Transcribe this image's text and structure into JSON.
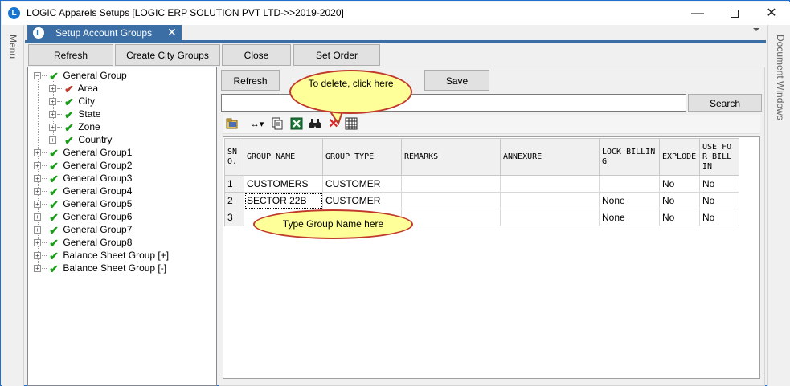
{
  "window": {
    "title": "LOGIC Apparels Setups  [LOGIC ERP SOLUTION PVT LTD->>2019-2020]",
    "logo_letter": "L",
    "minimize_glyph": "—",
    "close_glyph": "✕"
  },
  "sidebar_left": {
    "label": "Menu"
  },
  "sidebar_right": {
    "label": "Document Windows"
  },
  "tab": {
    "label": "Setup Account Groups",
    "icon_letter": "L",
    "close_glyph": "✕"
  },
  "top_buttons": {
    "refresh": "Refresh",
    "create_city_groups": "Create City Groups",
    "close": "Close",
    "set_order": "Set Order"
  },
  "tree": {
    "root": {
      "label": "General Group",
      "expander": "−"
    },
    "children": [
      {
        "label": "Area",
        "check_color": "#c0392b"
      },
      {
        "label": "City",
        "check_color": "#1a9b1a"
      },
      {
        "label": "State",
        "check_color": "#1a9b1a"
      },
      {
        "label": "Zone",
        "check_color": "#1a9b1a"
      },
      {
        "label": "Country",
        "check_color": "#1a9b1a"
      }
    ],
    "siblings": [
      {
        "label": "General Group1"
      },
      {
        "label": "General Group2"
      },
      {
        "label": "General Group3"
      },
      {
        "label": "General Group4"
      },
      {
        "label": "General Group5"
      },
      {
        "label": "General Group6"
      },
      {
        "label": "General Group7"
      },
      {
        "label": "General Group8"
      },
      {
        "label": "Balance Sheet Group [+]"
      },
      {
        "label": "Balance Sheet Group [-]"
      }
    ],
    "check_glyph": "✔",
    "collapsed_glyph": "+"
  },
  "main": {
    "refresh_label": "Refresh",
    "save_label": "Save",
    "search_value": "",
    "search_label": "Search"
  },
  "toolbar": {
    "icons": [
      "folder-icon",
      "column-width-icon",
      "copy-icon",
      "excel-icon",
      "find-icon",
      "delete-icon",
      "grid-icon"
    ],
    "width_glyph": "↔▾",
    "delete_glyph": "✕",
    "find_glyph": "⌕"
  },
  "grid": {
    "columns": [
      "SNO.",
      "GROUP NAME",
      "GROUP TYPE",
      "REMARKS",
      "ANNEXURE",
      "LOCK BILLING",
      "EXPLODE",
      "USE FOR BILLIN"
    ],
    "rows": [
      {
        "sno": "1",
        "group_name": "CUSTOMERS",
        "group_type": "CUSTOMER",
        "remarks": "",
        "annexure": "",
        "lock_billing": "",
        "explode": "No",
        "use_for_billing": "No"
      },
      {
        "sno": "2",
        "group_name": "SECTOR 22B",
        "group_type": "CUSTOMER",
        "remarks": "",
        "annexure": "",
        "lock_billing": "None",
        "explode": "No",
        "use_for_billing": "No"
      },
      {
        "sno": "3",
        "group_name": "",
        "group_type": "",
        "remarks": "",
        "annexure": "",
        "lock_billing": "None",
        "explode": "No",
        "use_for_billing": "No"
      }
    ]
  },
  "callouts": {
    "delete": "To  delete,  click here",
    "type_name": "Type  Group  Name  here"
  },
  "colors": {
    "accent": "#3a6ea5",
    "check_green": "#1a9b1a",
    "check_red": "#c0392b",
    "callout_fill": "#ffff99",
    "callout_border": "#c0392b"
  }
}
